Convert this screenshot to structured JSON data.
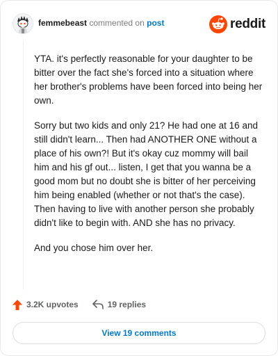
{
  "header": {
    "username": "femmebeast",
    "action_text": "commented on",
    "post_link": "post",
    "brand": "reddit"
  },
  "comment": {
    "paragraphs": [
      "YTA. it's perfectly reasonable for your daughter to be bitter over the fact she's forced into a situation where her brother's problems have been forced into being her own.",
      "Sorry but two kids and only 21? He had one at 16 and still didn't learn... Then had ANOTHER ONE without a place of his own?! But it's okay cuz mommy will bail him and his gf out... listen, I get that you wanna be a good mom but no doubt she is bitter of her perceiving him being enabled (whether or not that's the case). Then having to live with another person she probably didn't like to begin with. AND she has no privacy.",
      "And you chose him over her."
    ]
  },
  "actions": {
    "upvotes": "3.2K upvotes",
    "replies": "19 replies"
  },
  "footer": {
    "view_comments": "View 19 comments"
  },
  "colors": {
    "accent": "#0079d3",
    "upvote": "#ff4500",
    "reddit_orange": "#ff4500"
  },
  "icons": [
    "avatar",
    "reddit-logo-icon",
    "upvote-arrow-icon",
    "reply-icon"
  ]
}
